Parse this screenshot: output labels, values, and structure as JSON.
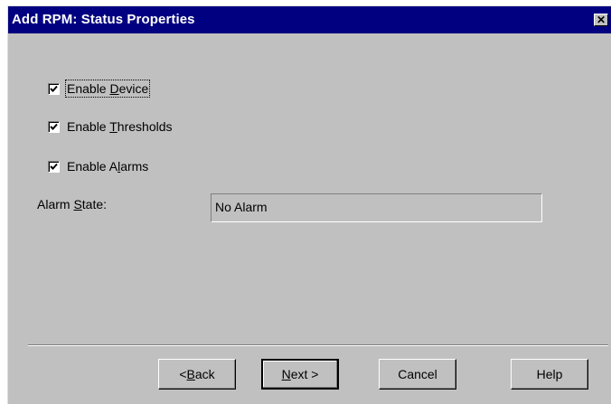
{
  "window": {
    "title": "Add RPM: Status Properties",
    "close_glyph": "✕",
    "close_icon": "close-icon"
  },
  "options": [
    {
      "pre": "Enable ",
      "key": "D",
      "post": "evice",
      "checked": true
    },
    {
      "pre": "Enable ",
      "key": "T",
      "post": "hresholds",
      "checked": true
    },
    {
      "pre": "Enable A",
      "key": "l",
      "post": "arms",
      "checked": true
    }
  ],
  "alarm_state": {
    "label_pre": "Alarm ",
    "label_key": "S",
    "label_post": "tate:",
    "value": "No Alarm"
  },
  "buttons": {
    "back": {
      "pre": "< ",
      "key": "B",
      "post": "ack"
    },
    "next": {
      "pre": "",
      "key": "N",
      "post": "ext >"
    },
    "cancel": "Cancel",
    "help": "Help"
  },
  "colors": {
    "titlebar": "#000080",
    "dialog_bg": "#c0c0c0"
  }
}
